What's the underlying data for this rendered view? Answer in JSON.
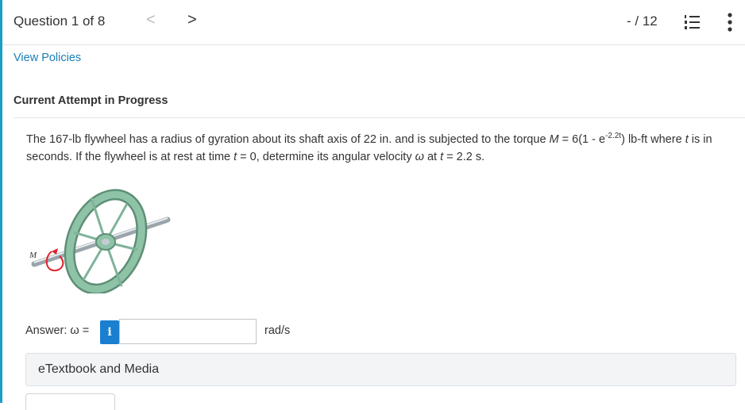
{
  "header": {
    "question_counter": "Question 1 of 8",
    "prev_glyph": "<",
    "next_glyph": ">",
    "score": "- / 12"
  },
  "links": {
    "view_policies": "View Policies"
  },
  "attempt": {
    "title": "Current Attempt in Progress"
  },
  "question": {
    "text_part1": "The 167-lb flywheel has a radius of gyration about its shaft axis of 22 in. and is subjected to the torque ",
    "M": "M",
    "text_part2": " = 6(1 - e",
    "exponent": "-2.2t",
    "text_part3": ") lb-ft where ",
    "t1": "t",
    "text_part4": " is in seconds. If the flywheel is at rest at time ",
    "t2": "t",
    "text_part5": " = 0, determine its angular velocity ",
    "omega": "ω",
    "text_part6": " at ",
    "t3": "t",
    "text_part7": " = 2.2 s."
  },
  "figure": {
    "label_M": "M"
  },
  "answer": {
    "label": "Answer: ω =",
    "info": "i",
    "value": "",
    "unit": "rad/s"
  },
  "resources": {
    "etextbook_label": "eTextbook and Media"
  },
  "colors": {
    "accent_stripe": "#1a9fc4",
    "link": "#1a7fb8",
    "info_button": "#1a7fd0",
    "flywheel": "#7fb39a",
    "torque_arrow": "#e0202a"
  }
}
